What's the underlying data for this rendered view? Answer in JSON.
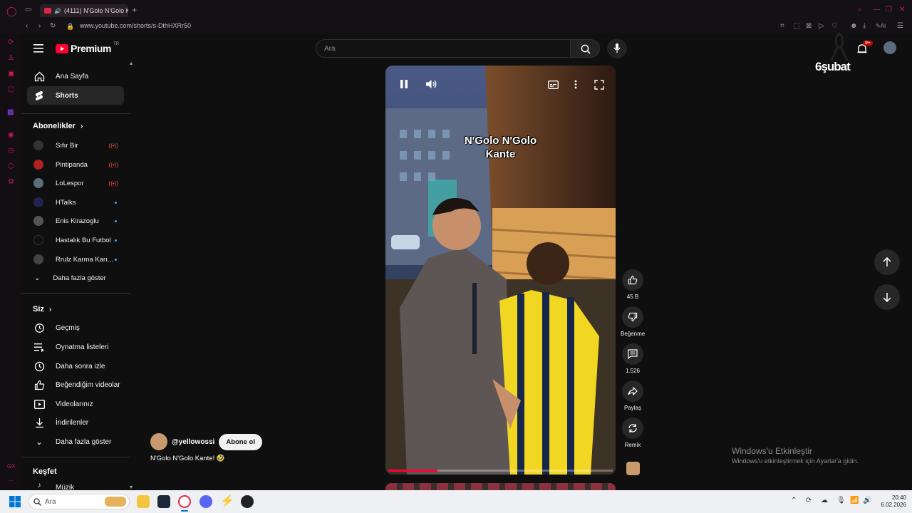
{
  "browser": {
    "tab_title": "(4111) N'Golo N'Golo K",
    "url": "www.youtube.com/shorts/s-DthHXRr50"
  },
  "youtube": {
    "logo_text": "Premium",
    "logo_badge": "TR",
    "search_placeholder": "Ara",
    "notif_count": "9+",
    "doodle_text": "6şubat"
  },
  "sidebar": {
    "main": [
      {
        "label": "Ana Sayfa",
        "icon": "home-icon"
      },
      {
        "label": "Shorts",
        "icon": "shorts-icon",
        "active": true
      }
    ],
    "subscriptions_title": "Abonelikler",
    "subscriptions": [
      {
        "label": "Sıfır Bir",
        "status": "live",
        "color": "#333333"
      },
      {
        "label": "Pintipanda",
        "status": "live",
        "color": "#b22222"
      },
      {
        "label": "LoLespor",
        "status": "live",
        "color": "#5b6f7a"
      },
      {
        "label": "HTalks",
        "status": "new",
        "color": "#23234f"
      },
      {
        "label": "Enis Kirazoglu",
        "status": "new",
        "color": "#555555"
      },
      {
        "label": "Hastalık Bu Futbol",
        "status": "new",
        "color": "#111111"
      },
      {
        "label": "Rrulz Karma Karı...",
        "status": "new",
        "color": "#444444"
      }
    ],
    "show_more_1": "Daha fazla göster",
    "you_title": "Siz",
    "you_items": [
      {
        "label": "Geçmiş",
        "icon": "history-icon"
      },
      {
        "label": "Oynatma listeleri",
        "icon": "playlists-icon"
      },
      {
        "label": "Daha sonra izle",
        "icon": "watch-later-icon"
      },
      {
        "label": "Beğendiğim videolar",
        "icon": "liked-icon"
      },
      {
        "label": "Videolarınız",
        "icon": "your-videos-icon"
      },
      {
        "label": "İndirilenler",
        "icon": "downloads-icon"
      }
    ],
    "show_more_2": "Daha fazla göster",
    "explore_title": "Keşfet",
    "explore_items": [
      {
        "label": "Müzik",
        "icon": "music-icon"
      }
    ]
  },
  "short": {
    "overlay_caption_line1": "N'Golo N'Golo",
    "overlay_caption_line2": "Kante",
    "channel": "@yellowossi",
    "subscribe_label": "Abone ol",
    "title": "N'Golo N'Golo Kante! 🤣",
    "like_count": "45 B",
    "dislike_label": "Beğenme",
    "comment_count": "1.526",
    "share_label": "Paylaş",
    "remix_label": "Remix",
    "progress": 0.22
  },
  "activation": {
    "title": "Windows'u Etkinleştir",
    "body": "Windows'u etkinleştirmek için Ayarlar'a gidin."
  },
  "taskbar": {
    "search_label": "Ara",
    "time": "20:40",
    "date": "6.02.2026"
  },
  "colors": {
    "accent_red": "#ff0033",
    "opera_red": "#c8204b",
    "link_blue": "#3ea6ff"
  }
}
